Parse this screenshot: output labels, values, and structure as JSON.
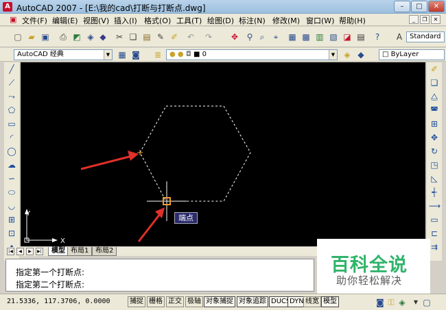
{
  "title": {
    "app_icon": "A",
    "text": "AutoCAD 2007 - [E:\\我的cad\\打断与打断点.dwg]",
    "minimize": "–",
    "maximize": "□",
    "close": "✕"
  },
  "menu": [
    {
      "label": "文件(F)"
    },
    {
      "label": "编辑(E)"
    },
    {
      "label": "视图(V)"
    },
    {
      "label": "插入(I)"
    },
    {
      "label": "格式(O)"
    },
    {
      "label": "工具(T)"
    },
    {
      "label": "绘图(D)"
    },
    {
      "label": "标注(N)"
    },
    {
      "label": "修改(M)"
    },
    {
      "label": "窗口(W)"
    },
    {
      "label": "帮助(H)"
    }
  ],
  "toolbar1": {
    "text_style": "Standard"
  },
  "toolbar2": {
    "workspace": "AutoCAD 经典",
    "layer": "0",
    "color": "ByLayer"
  },
  "drawing": {
    "snap_tooltip": "端点",
    "ucs_x": "X",
    "ucs_y": "Y"
  },
  "tabs": [
    {
      "label": "模型"
    },
    {
      "label": "布局1"
    },
    {
      "label": "布局2"
    }
  ],
  "command": {
    "line1": "指定第一个打断点:",
    "line2": "指定第二个打断点:"
  },
  "watermark": {
    "brand": "百科全说",
    "slogan": "助你轻松解决"
  },
  "status": {
    "coords": "21.5336,  117.3706, 0.0000",
    "buttons": [
      {
        "label": "捕捉"
      },
      {
        "label": "栅格"
      },
      {
        "label": "正交"
      },
      {
        "label": "极轴"
      },
      {
        "label": "对象捕捉"
      },
      {
        "label": "对象追踪"
      },
      {
        "label": "DUCS"
      },
      {
        "label": "DYN"
      },
      {
        "label": "线宽"
      },
      {
        "label": "模型"
      }
    ]
  },
  "colors": {
    "canvas": "#000000",
    "hexagon": "#ffffff",
    "arrow": "#e0302a",
    "snap_marker": "#f0a030",
    "brand_green": "#2fb46a"
  }
}
